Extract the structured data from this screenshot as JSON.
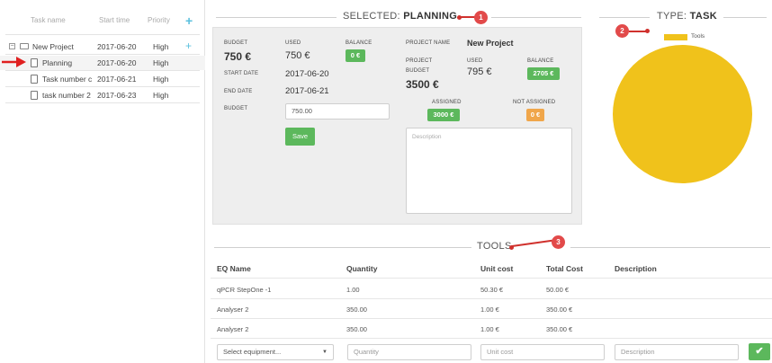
{
  "tree": {
    "columns": {
      "name": "Task name",
      "start": "Start time",
      "priority": "Priority"
    },
    "add_icon": "+",
    "rows": [
      {
        "name": "New Project",
        "start": "2017-06-20",
        "priority": "High",
        "kind": "project"
      },
      {
        "name": "Planning",
        "start": "2017-06-20",
        "priority": "High",
        "kind": "task"
      },
      {
        "name": "Task number c",
        "start": "2017-06-21",
        "priority": "High",
        "kind": "task"
      },
      {
        "name": "task number 2",
        "start": "2017-06-23",
        "priority": "High",
        "kind": "task"
      }
    ],
    "toggle_symbol": "−"
  },
  "selected": {
    "title_prefix": "SELECTED:",
    "title_name": "PLANNING",
    "badge": "1",
    "budget_label": "BUDGET",
    "budget_value": "750 €",
    "used_label": "USED",
    "used_value": "750 €",
    "balance_label": "BALANCE",
    "balance_value": "0 €",
    "start_label": "START DATE",
    "start_value": "2017-06-20",
    "end_label": "END DATE",
    "end_value": "2017-06-21",
    "budget_input_label": "BUDGET",
    "budget_input_value": "750.00",
    "save_label": "Save",
    "project_name_label": "PROJECT NAME",
    "project_name_value": "New Project",
    "project_label": "PROJECT",
    "project_budget_label": "BUDGET",
    "project_budget_value": "3500 €",
    "project_used_label": "USED",
    "project_used_value": "795 €",
    "project_balance_label": "BALANCE",
    "project_balance_value": "2705 €",
    "assigned_label": "ASSIGNED",
    "assigned_value": "3000 €",
    "not_assigned_label": "NOT ASSIGNED",
    "not_assigned_value": "0 €",
    "description_placeholder": "Description"
  },
  "type_panel": {
    "title_prefix": "TYPE:",
    "title_name": "TASK",
    "badge": "2",
    "legend": "Tools",
    "pie_color": "#f0c21b"
  },
  "tools": {
    "title": "TOOLS",
    "badge": "3",
    "headers": {
      "name": "EQ Name",
      "quantity": "Quantity",
      "unit": "Unit cost",
      "total": "Total Cost",
      "description": "Description"
    },
    "rows": [
      {
        "name": "qPCR StepOne -1",
        "quantity": "1.00",
        "unit": "50.30 €",
        "total": "50.00 €"
      },
      {
        "name": "Analyser 2",
        "quantity": "350.00",
        "unit": "1.00 €",
        "total": "350.00 €"
      },
      {
        "name": "Analyser 2",
        "quantity": "350.00",
        "unit": "1.00 €",
        "total": "350.00 €"
      }
    ],
    "select_placeholder": "Select equipment...",
    "quantity_placeholder": "Quantity",
    "unit_placeholder": "Unit cost",
    "description_placeholder": "Description",
    "confirm_symbol": "✔"
  },
  "colors": {
    "accent_green": "#5cb85c",
    "accent_orange": "#f0a64a",
    "annotation_red": "#e24a4a",
    "add_blue": "#5bc0de"
  }
}
